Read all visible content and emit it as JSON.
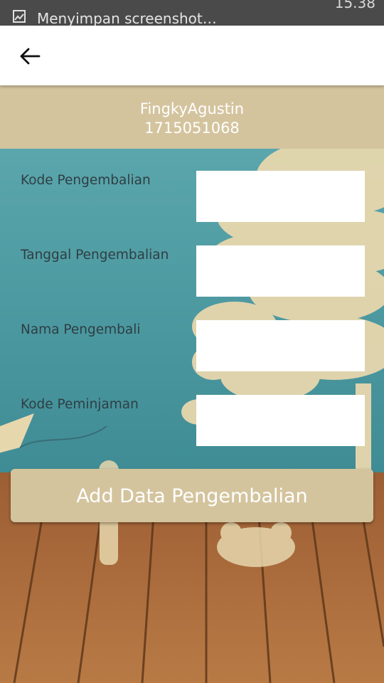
{
  "status_bar": {
    "notification_icon": "image-icon",
    "notification_text": "Menyimpan screenshot…",
    "clock": "15.38"
  },
  "toolbar": {
    "back_icon": "arrow-left-icon"
  },
  "user": {
    "name": "FingkyAgustin",
    "nim": "1715051068"
  },
  "form": {
    "fields": [
      {
        "label": "Kode Pengembalian",
        "value": ""
      },
      {
        "label": "Tanggal Pengembalian",
        "value": ""
      },
      {
        "label": "Nama Pengembali",
        "value": ""
      },
      {
        "label": "Kode Peminjaman",
        "value": ""
      }
    ],
    "submit_label": "Add Data Pengembalian"
  },
  "colors": {
    "header_bg": "#d4c49e",
    "button_bg": "#d4c49e",
    "sky": "#4f9aa3",
    "floor": "#a8693a",
    "label_text": "#2f3e44"
  }
}
